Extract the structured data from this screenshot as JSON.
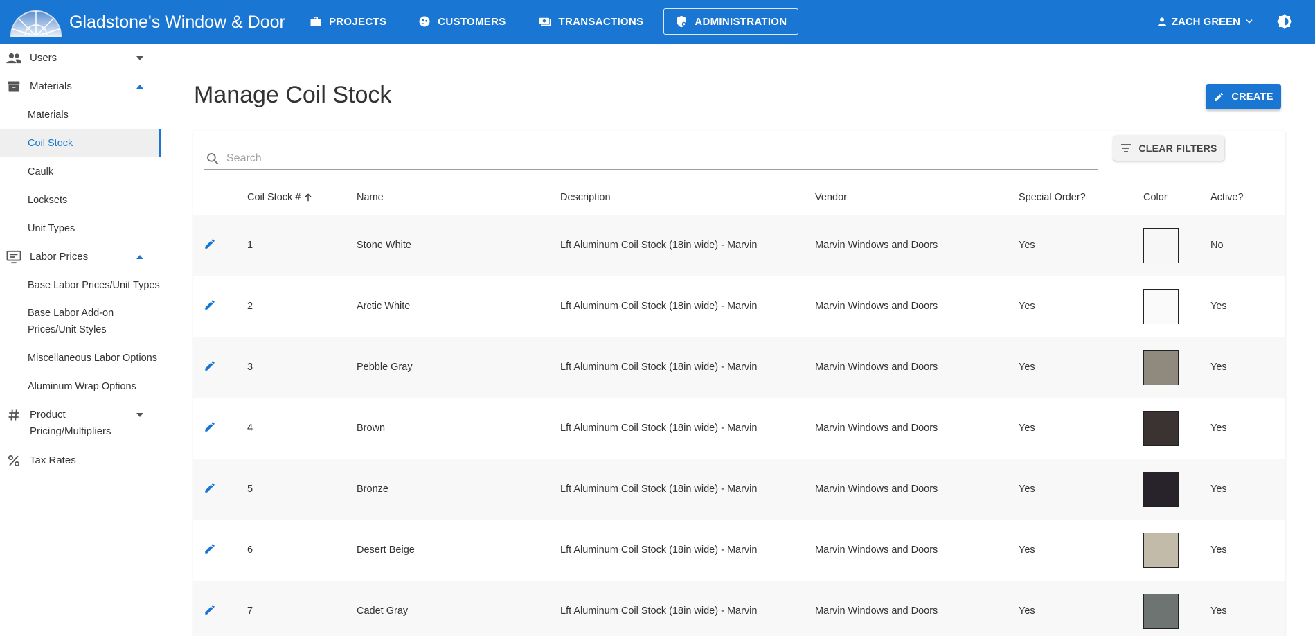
{
  "app": {
    "brand": "Gladstone's Window & Door"
  },
  "nav": {
    "items": [
      {
        "label": "PROJECTS",
        "icon": "briefcase-icon"
      },
      {
        "label": "CUSTOMERS",
        "icon": "customers-icon"
      },
      {
        "label": "TRANSACTIONS",
        "icon": "transactions-icon"
      },
      {
        "label": "ADMINISTRATION",
        "icon": "admin-shield-icon",
        "active": true
      }
    ],
    "user": "ZACH GREEN"
  },
  "sidebar": {
    "users": "Users",
    "materials": "Materials",
    "materials_items": [
      "Materials",
      "Coil Stock",
      "Caulk",
      "Locksets",
      "Unit Types"
    ],
    "labor_prices": "Labor Prices",
    "labor_items": [
      "Base Labor Prices/Unit Types",
      "Base Labor Add-on Prices/Unit Styles",
      "Miscellaneous Labor Options",
      "Aluminum Wrap Options"
    ],
    "product_pricing": "Product Pricing/Multipliers",
    "tax_rates": "Tax Rates",
    "selected": "Coil Stock"
  },
  "page": {
    "title": "Manage Coil Stock",
    "create_label": "CREATE",
    "search_placeholder": "Search",
    "clear_filters_label": "CLEAR FILTERS"
  },
  "table": {
    "columns": [
      "Coil Stock #",
      "Name",
      "Description",
      "Vendor",
      "Special Order?",
      "Color",
      "Active?"
    ],
    "rows": [
      {
        "num": "1",
        "name": "Stone White",
        "description": "Lft Aluminum Coil Stock (18in wide) - Marvin",
        "vendor": "Marvin Windows and Doors",
        "special": "Yes",
        "color": "#f7f7f7",
        "active": "No"
      },
      {
        "num": "2",
        "name": "Arctic White",
        "description": "Lft Aluminum Coil Stock (18in wide) - Marvin",
        "vendor": "Marvin Windows and Doors",
        "special": "Yes",
        "color": "#fafafa",
        "active": "Yes"
      },
      {
        "num": "3",
        "name": "Pebble Gray",
        "description": "Lft Aluminum Coil Stock (18in wide) - Marvin",
        "vendor": "Marvin Windows and Doors",
        "special": "Yes",
        "color": "#8f8a7d",
        "active": "Yes"
      },
      {
        "num": "4",
        "name": "Brown",
        "description": "Lft Aluminum Coil Stock (18in wide) - Marvin",
        "vendor": "Marvin Windows and Doors",
        "special": "Yes",
        "color": "#3b3331",
        "active": "Yes"
      },
      {
        "num": "5",
        "name": "Bronze",
        "description": "Lft Aluminum Coil Stock (18in wide) - Marvin",
        "vendor": "Marvin Windows and Doors",
        "special": "Yes",
        "color": "#28232a",
        "active": "Yes"
      },
      {
        "num": "6",
        "name": "Desert Beige",
        "description": "Lft Aluminum Coil Stock (18in wide) - Marvin",
        "vendor": "Marvin Windows and Doors",
        "special": "Yes",
        "color": "#c3bba9",
        "active": "Yes"
      },
      {
        "num": "7",
        "name": "Cadet Gray",
        "description": "Lft Aluminum Coil Stock (18in wide) - Marvin",
        "vendor": "Marvin Windows and Doors",
        "special": "Yes",
        "color": "#6e7472",
        "active": "Yes"
      }
    ]
  },
  "colors": {
    "primary": "#1976d2"
  }
}
